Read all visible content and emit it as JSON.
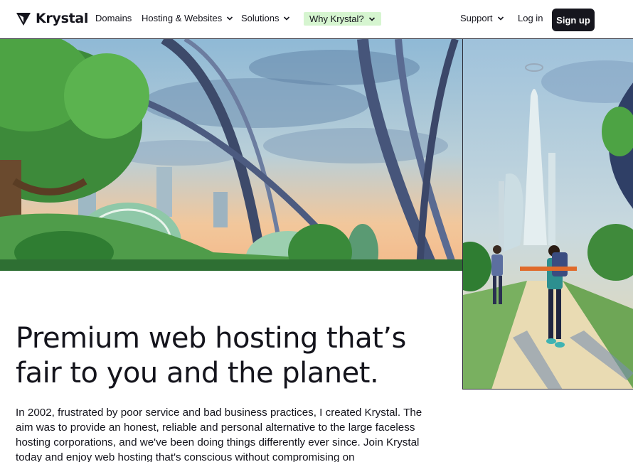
{
  "brand": {
    "name": "Krystal"
  },
  "nav": {
    "items": [
      {
        "label": "Domains"
      },
      {
        "label": "Hosting & Websites"
      },
      {
        "label": "Solutions"
      },
      {
        "label": "Why Krystal?"
      }
    ],
    "support": "Support",
    "login": "Log in",
    "signup": "Sign up"
  },
  "hero": {
    "headline_line1": "Premium web hosting that’s",
    "headline_line2": "fair to you and the planet.",
    "intro": "In 2002, frustrated by poor service and bad business practices, I created Krystal. The aim was to provide an honest, reliable and personal alternative to the large faceless hosting corporations, and we've been doing things differently ever since. Join Krystal today and enjoy web hosting that's conscious without compromising on"
  },
  "colors": {
    "highlight": "#d6f5d0",
    "signup_bg": "#16161e",
    "text": "#14141c"
  },
  "icons": [
    "krystal-logo-icon",
    "chevron-down-icon"
  ]
}
